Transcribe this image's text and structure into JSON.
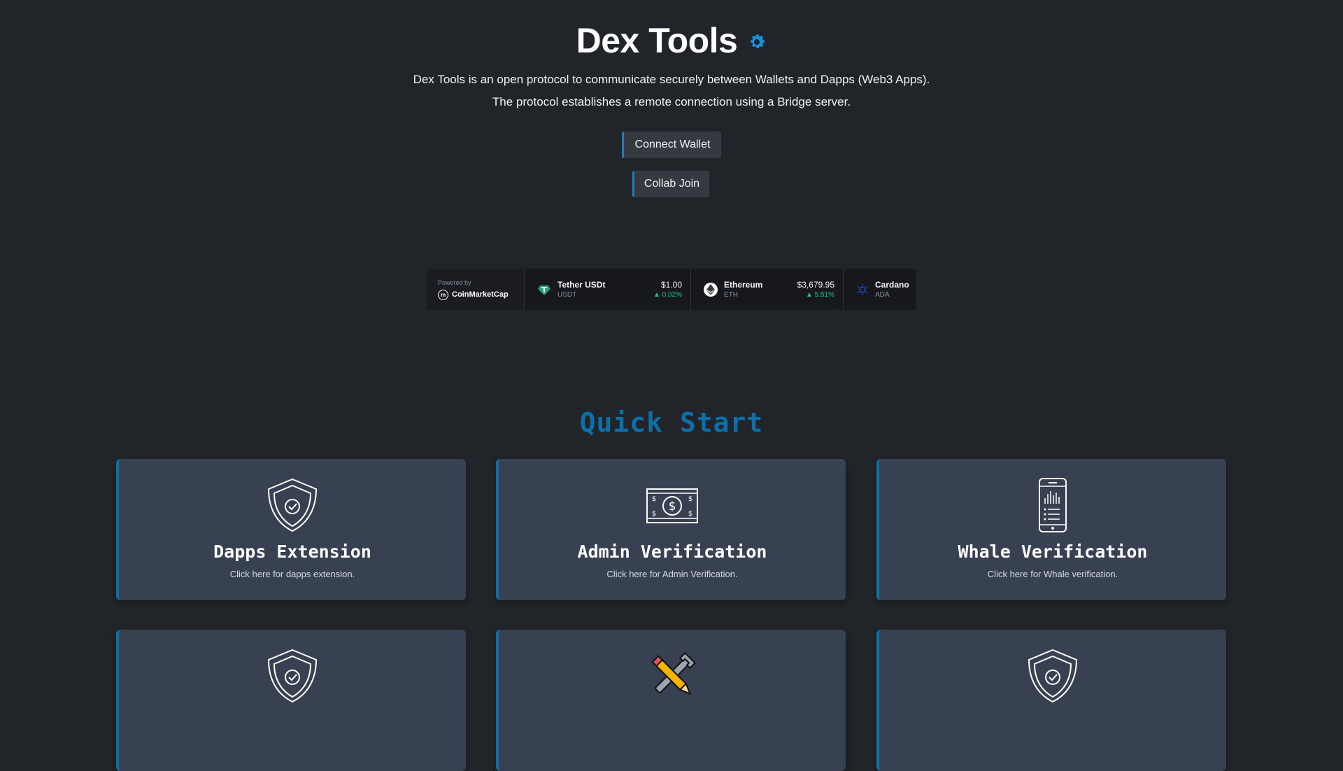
{
  "header": {
    "title": "Dex Tools",
    "description_line1": "Dex Tools is an open protocol to communicate securely between Wallets and Dapps (Web3 Apps).",
    "description_line2": "The protocol establishes a remote connection using a Bridge server.",
    "accent_color": "#0d6ea8"
  },
  "buttons": {
    "connect_label": "Connect Wallet",
    "collab_label": "Collab Join"
  },
  "ticker": {
    "powered_by": "Powered by",
    "brand": "CoinMarketCap",
    "coins": [
      {
        "name": "Tether USDt",
        "symbol": "USDT",
        "price": "$1.00",
        "change": "0.02%",
        "icon": "tether-icon"
      },
      {
        "name": "Ethereum",
        "symbol": "ETH",
        "price": "$3,679.95",
        "change": "5.51%",
        "icon": "ethereum-icon"
      },
      {
        "name": "Cardano",
        "symbol": "ADA",
        "icon": "cardano-icon"
      }
    ],
    "up_color": "#16c784"
  },
  "quick_start": {
    "heading": "Quick Start",
    "cards": [
      {
        "title": "Dapps Extension",
        "subtitle": "Click here for dapps extension.",
        "icon": "shield-check-icon"
      },
      {
        "title": "Admin Verification",
        "subtitle": "Click here for Admin Verification.",
        "icon": "banknote-icon"
      },
      {
        "title": "Whale Verification",
        "subtitle": "Click here for Whale verification.",
        "icon": "phone-chart-icon"
      },
      {
        "title": "",
        "subtitle": "",
        "icon": "shield-check-icon"
      },
      {
        "title": "",
        "subtitle": "",
        "icon": "tools-icon"
      },
      {
        "title": "",
        "subtitle": "",
        "icon": "shield-check-icon"
      }
    ]
  }
}
